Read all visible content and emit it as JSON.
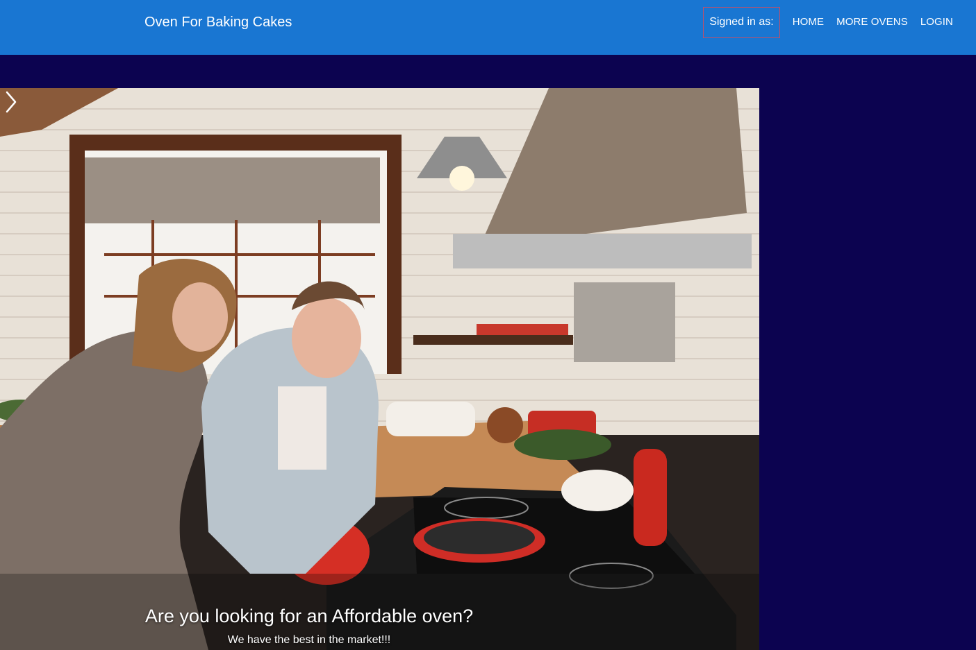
{
  "navbar": {
    "brand": "Oven For Baking Cakes",
    "signed_in_label": "Signed in as:",
    "links": [
      "HOME",
      "MORE OVENS",
      "LOGIN"
    ]
  },
  "hero": {
    "title": "Are you looking for an Affordable oven?",
    "subtitle": "We have the best in the market!!!"
  },
  "colors": {
    "navbar_bg": "#1976d2",
    "page_bg": "#0c0350",
    "signed_in_border": "#c0506a"
  },
  "icons": {
    "carousel_next": "chevron-right-icon"
  }
}
